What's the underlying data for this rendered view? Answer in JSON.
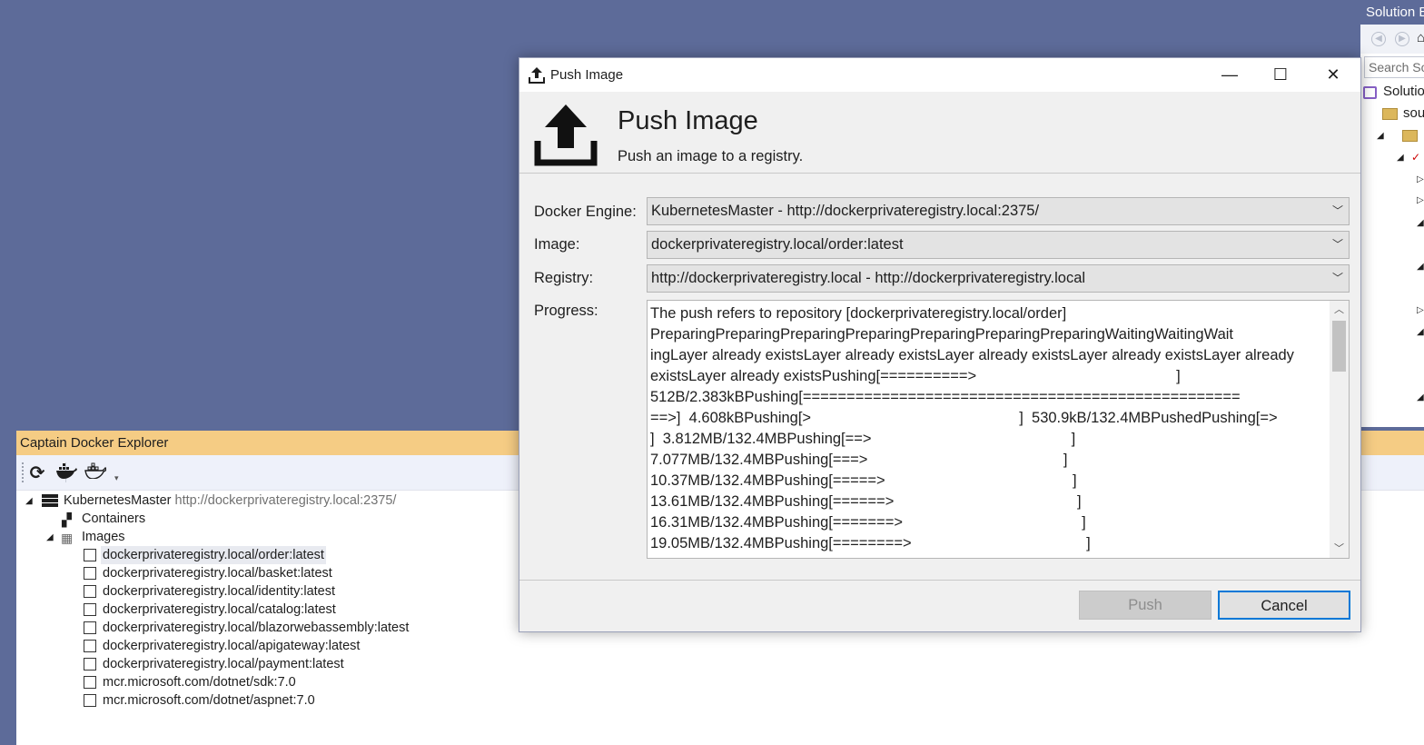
{
  "solution_explorer": {
    "title": "Solution E",
    "search_placeholder": "Search So",
    "solution_label": "Solutio",
    "folder_label": "sou"
  },
  "explorer": {
    "title": "Captain Docker Explorer",
    "server": {
      "name": "KubernetesMaster",
      "url": "http://dockerprivateregistry.local:2375/"
    },
    "containers_label": "Containers",
    "images_label": "Images",
    "images": [
      "dockerprivateregistry.local/order:latest",
      "dockerprivateregistry.local/basket:latest",
      "dockerprivateregistry.local/identity:latest",
      "dockerprivateregistry.local/catalog:latest",
      "dockerprivateregistry.local/blazorwebassembly:latest",
      "dockerprivateregistry.local/apigateway:latest",
      "dockerprivateregistry.local/payment:latest",
      "mcr.microsoft.com/dotnet/sdk:7.0",
      "mcr.microsoft.com/dotnet/aspnet:7.0"
    ]
  },
  "dialog": {
    "window_title": "Push Image",
    "header_title": "Push Image",
    "header_subtitle": "Push an image to a registry.",
    "engine_label": "Docker Engine:",
    "engine_value": "KubernetesMaster - http://dockerprivateregistry.local:2375/",
    "image_label": "Image:",
    "image_value": "dockerprivateregistry.local/order:latest",
    "registry_label": "Registry:",
    "registry_value": "http://dockerprivateregistry.local - http://dockerprivateregistry.local",
    "progress_label": "Progress:",
    "progress_lines": [
      "The push refers to repository [dockerprivateregistry.local/order]",
      "PreparingPreparingPreparingPreparingPreparingPreparingPreparingWaitingWaitingWait",
      "ingLayer already existsLayer already existsLayer already existsLayer already existsLayer already",
      "existsLayer already existsPushing[==========>                                                ]",
      "512B/2.383kBPushing[==================================================",
      "==>]  4.608kBPushing[>                                                  ]  530.9kB/132.4MBPushedPushing[=>",
      "]  3.812MB/132.4MBPushing[==>                                                ]",
      "7.077MB/132.4MBPushing[===>                                               ]",
      "10.37MB/132.4MBPushing[=====>                                             ]",
      "13.61MB/132.4MBPushing[======>                                            ]",
      "16.31MB/132.4MBPushing[=======>                                           ]",
      "19.05MB/132.4MBPushing[========>                                          ]"
    ],
    "push_label": "Push",
    "cancel_label": "Cancel"
  }
}
